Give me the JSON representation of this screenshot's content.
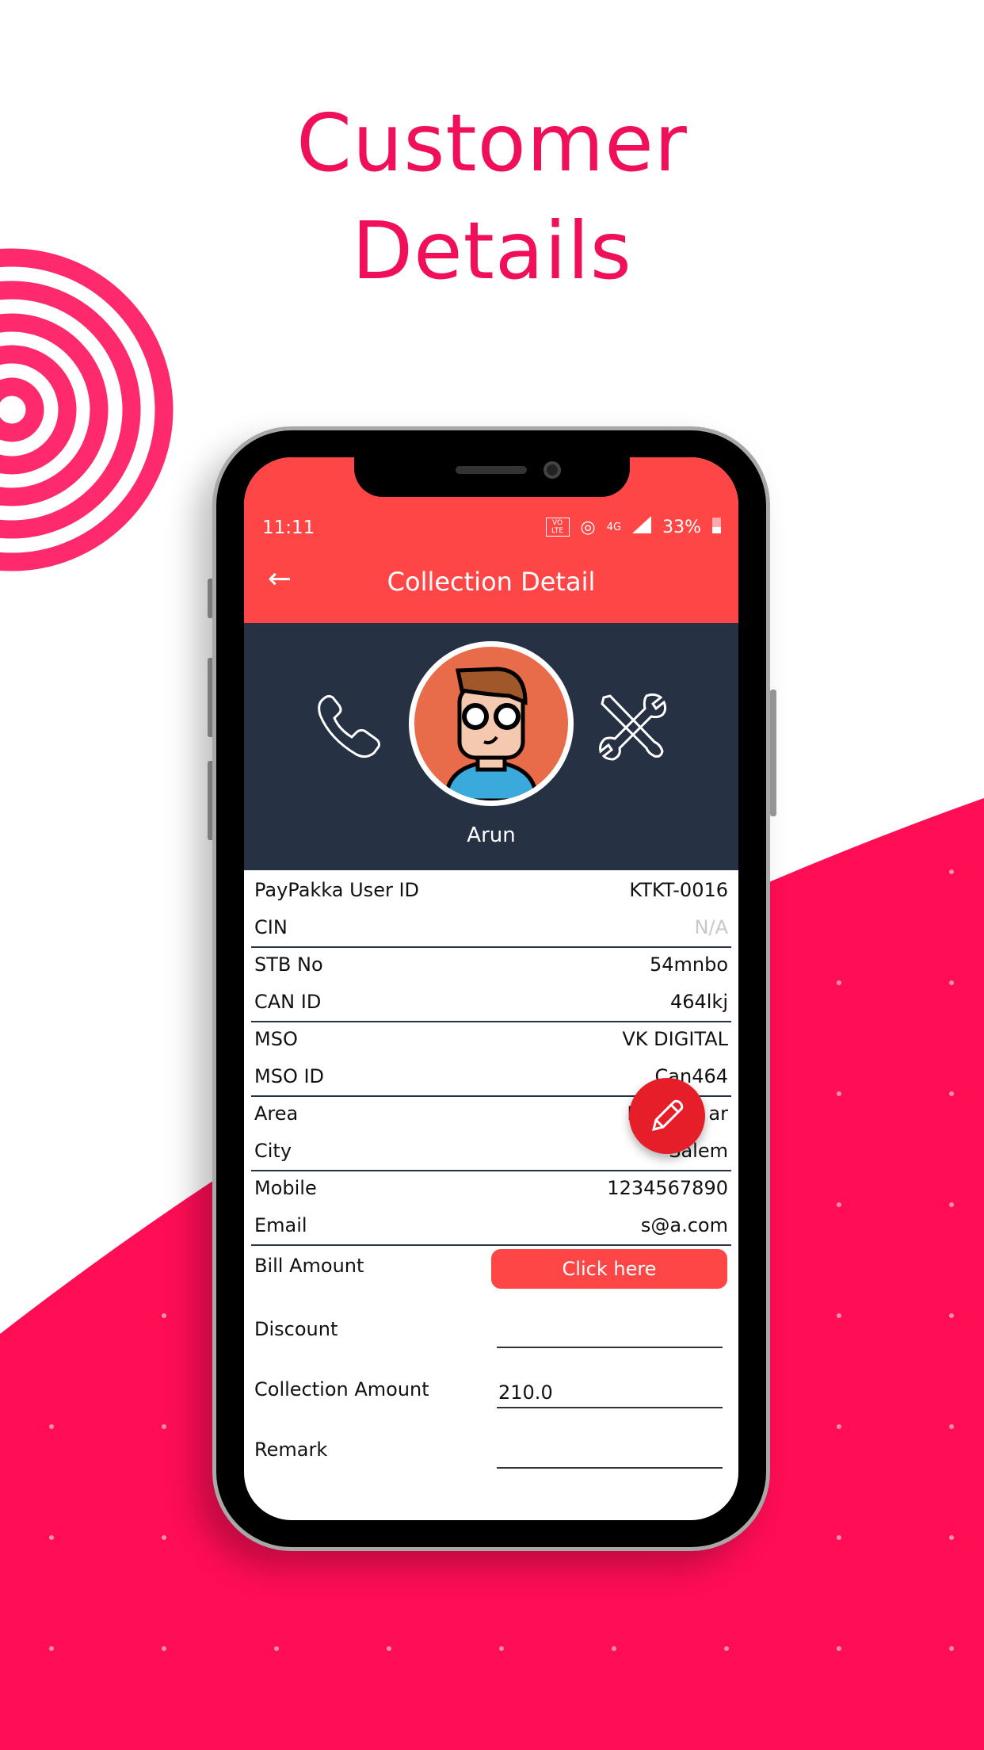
{
  "headline": {
    "line1": "Customer",
    "line2": "Details"
  },
  "colors": {
    "brand_pink": "#ff0d55",
    "app_red": "#ff4646",
    "header_dark": "#263143",
    "fab_red": "#e61e2a"
  },
  "status_bar": {
    "time": "11:11",
    "volte": "VO LTE",
    "network": "4G",
    "battery": "33%"
  },
  "app_bar": {
    "title": "Collection Detail",
    "back_icon": "arrow-left-icon"
  },
  "profile": {
    "name": "Arun",
    "left_icon": "phone-icon",
    "right_icon": "tools-icon"
  },
  "details": [
    {
      "label": "PayPakka User ID",
      "value": "KTKT-0016"
    },
    {
      "label": "CIN",
      "value": "N/A"
    },
    {
      "label": "STB No",
      "value": "54mnbo"
    },
    {
      "label": "CAN ID",
      "value": "464lkj"
    },
    {
      "label": "MSO",
      "value": "VK DIGITAL"
    },
    {
      "label": "MSO ID",
      "value": "Can464"
    },
    {
      "label": "Area",
      "value": "Neth      ar"
    },
    {
      "label": "City",
      "value": "Salem"
    },
    {
      "label": "Mobile",
      "value": "1234567890"
    },
    {
      "label": "Email",
      "value": "s@a.com"
    }
  ],
  "form": {
    "bill_amount_label": "Bill Amount",
    "bill_button": "Click here",
    "discount_label": "Discount",
    "discount_value": "",
    "collection_label": "Collection Amount",
    "collection_value": "210.0",
    "remark_label": "Remark",
    "remark_value": ""
  },
  "fab_icon": "pencil-icon"
}
